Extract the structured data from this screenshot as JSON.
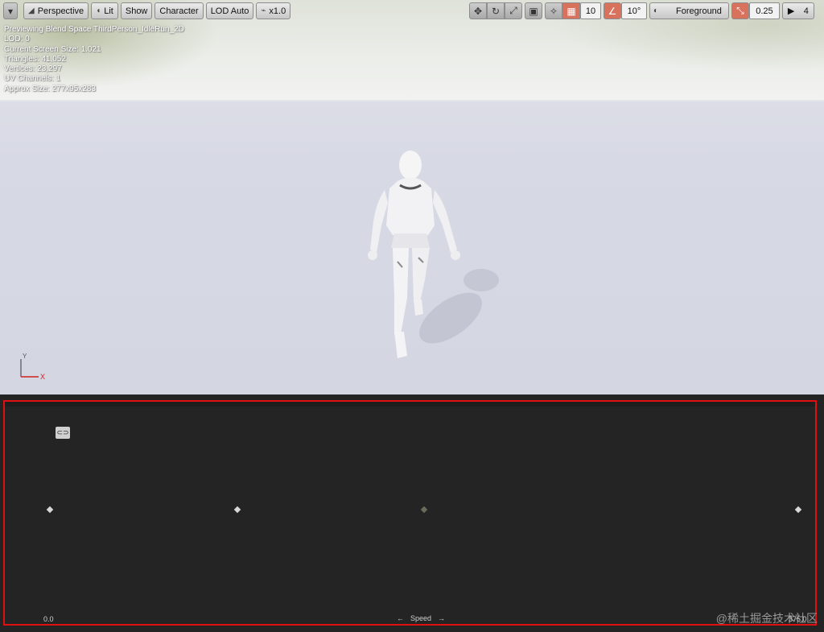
{
  "toolbar": {
    "left": {
      "menu_icon": "chevron-down-icon",
      "perspective_label": "Perspective",
      "lit_label": "Lit",
      "show_label": "Show",
      "character_label": "Character",
      "lod_label": "LOD Auto",
      "speed_label": "x1.0"
    },
    "right": {
      "translate_icon": "move-icon",
      "rotate_icon": "rotate-icon",
      "scale_icon": "scale-icon",
      "surface_icon": "cube-icon",
      "world_icon": "world-icon",
      "grid_snap_icon": "grid-icon",
      "grid_snap_value": "10",
      "rotation_snap_icon": "angle-icon",
      "rotation_snap_value": "10°",
      "layer_icon": "layer-icon",
      "layer_value": "Foreground",
      "scale_snap_icon": "scale-snap-icon",
      "scale_snap_value": "0.25",
      "camera_speed_icon": "camera-icon",
      "camera_speed_value": "4"
    }
  },
  "stats": [
    "Previewing Blend Space ThirdPerson_IdleRun_2D",
    "LOD: 0",
    "Current Screen Size: 1.021",
    "Triangles: 41,052",
    "Vertices: 23,297",
    "UV Channels: 1",
    "Approx Size: 277x95x283"
  ],
  "axis_gizmo": {
    "y": "Y",
    "x": "X"
  },
  "blend_panel": {
    "chip_icon": "tag-icon",
    "min_label": "0.0",
    "max_label": "375.0",
    "axis_label": "Speed",
    "left_arrow": "←",
    "right_arrow": "→",
    "samples": [
      {
        "speed": 0.0,
        "active": true
      },
      {
        "speed": 93.75,
        "active": true
      },
      {
        "speed": 187.5,
        "active": false
      },
      {
        "speed": 375.0,
        "active": true
      }
    ]
  },
  "watermark": "@稀土掘金技术社区",
  "colors": {
    "highlight_border": "#e01010",
    "panel_bg": "#242424",
    "snap_active": "#d9725c"
  }
}
